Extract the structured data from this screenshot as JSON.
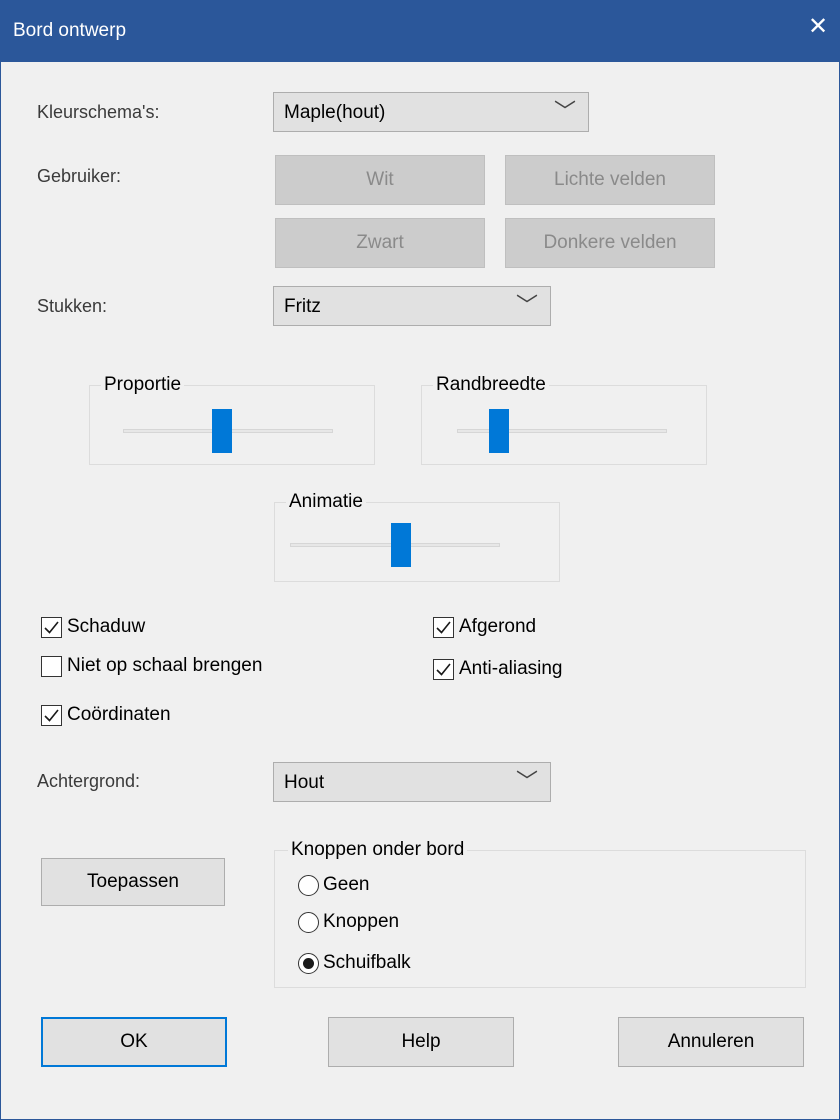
{
  "window": {
    "title": "Bord ontwerp",
    "close_glyph": "✕"
  },
  "colorscheme": {
    "label": "Kleurschema's:",
    "value": "Maple(hout)"
  },
  "user": {
    "label": "Gebruiker:",
    "white_label": "Wit",
    "light_fields_label": "Lichte velden",
    "black_label": "Zwart",
    "dark_fields_label": "Donkere velden"
  },
  "pieces": {
    "label": "Stukken:",
    "value": "Fritz"
  },
  "sliders": {
    "proportion": {
      "title": "Proportie",
      "level": 0.47
    },
    "border_width": {
      "title": "Randbreedte",
      "level": 0.17
    },
    "animation": {
      "title": "Animatie",
      "level": 0.53
    }
  },
  "checkboxes": {
    "shadow": {
      "label": "Schaduw",
      "checked": true
    },
    "no_scaling": {
      "label": "Niet op schaal brengen",
      "checked": false
    },
    "coordinates": {
      "label": "Coördinaten",
      "checked": true
    },
    "rounded": {
      "label": "Afgerond",
      "checked": true
    },
    "antialiasing": {
      "label": "Anti-aliasing",
      "checked": true
    }
  },
  "background": {
    "label": "Achtergrond:",
    "value": "Hout"
  },
  "apply_label": "Toepassen",
  "buttons_under_board": {
    "title": "Knoppen onder bord",
    "options": [
      {
        "label": "Geen",
        "selected": false
      },
      {
        "label": "Knoppen",
        "selected": false
      },
      {
        "label": "Schuifbalk",
        "selected": true
      }
    ]
  },
  "footer": {
    "ok_label": "OK",
    "help_label": "Help",
    "cancel_label": "Annuleren"
  },
  "colors": {
    "titlebar": "#2b579a",
    "accent": "#0078d7",
    "dialog_bg": "#f0f0f0"
  }
}
